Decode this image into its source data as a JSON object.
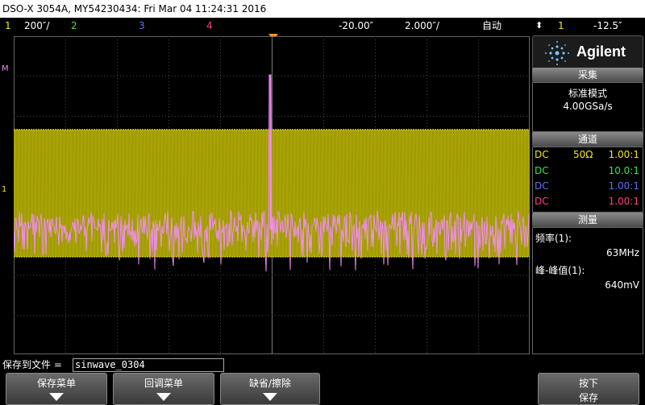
{
  "window": {
    "title": "DSO-X 3054A, MY54230434: Fri Mar 04 11:24:31 2016"
  },
  "statusbar": {
    "ch1_num": "1",
    "ch1_scale": "200″/",
    "ch2_num": "2",
    "ch3_num": "3",
    "ch4_num": "4",
    "time_delay": "-20.00″",
    "time_scale": "2.000″/",
    "trigger_mode": "自动",
    "trigger_src": "1",
    "trigger_level": "-12.5″"
  },
  "colors": {
    "ch1": "#f2e61e",
    "ch2": "#3ee04a",
    "ch3": "#5c6cff",
    "ch4": "#ff3c78",
    "trace_math": "#f08cf0"
  },
  "panel": {
    "brand": "Agilent",
    "acquire": {
      "header": "采集",
      "mode": "标准模式",
      "rate": "4.00GSa/s"
    },
    "channels": {
      "header": "通道",
      "rows": [
        {
          "coupling": "DC",
          "impedance": "50Ω",
          "probe": "1.00:1"
        },
        {
          "coupling": "DC",
          "impedance": "",
          "probe": "10.0:1"
        },
        {
          "coupling": "DC",
          "impedance": "",
          "probe": "1.00:1"
        },
        {
          "coupling": "DC",
          "impedance": "",
          "probe": "1.00:1"
        }
      ]
    },
    "measure": {
      "header": "测量",
      "freq_label": "频率(1):",
      "freq_value": "63MHz",
      "pkpk_label": "峰-峰值(1):",
      "pkpk_value": "640mV"
    }
  },
  "savebar": {
    "label": "保存到文件 =",
    "filename": "sinwave_0304"
  },
  "softkeys": {
    "save_menu": "保存菜单",
    "recall_menu": "回调菜单",
    "default_erase": "缺省/擦除",
    "press_save_line1": "按下",
    "press_save_line2": "保存"
  },
  "markers": {
    "math_m": "M",
    "ch1_ground": "1"
  }
}
